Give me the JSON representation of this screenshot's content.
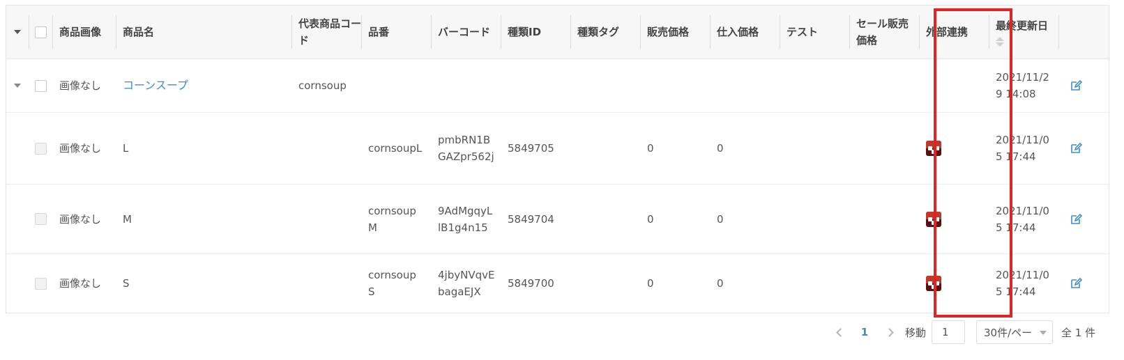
{
  "table": {
    "headers": [
      "商品画像",
      "商品名",
      "代表商品コード",
      "品番",
      "バーコード",
      "種類ID",
      "種類タグ",
      "販売価格",
      "仕入価格",
      "テスト",
      "セール販売価格",
      "外部連携",
      "最終更新日"
    ],
    "parent_row": {
      "image": "画像なし",
      "name": "コーンスープ",
      "code": "cornsoup",
      "updated": "2021/11/29 14:08"
    },
    "rows": [
      {
        "image": "画像なし",
        "name": "L",
        "part_no": "cornsoupL",
        "barcode": "pmbRN1BGAZpr562j",
        "type_id": "5849705",
        "sale_price": "0",
        "cost_price": "0",
        "updated": "2021/11/05 17:44"
      },
      {
        "image": "画像なし",
        "name": "M",
        "part_no": "cornsoupM",
        "barcode": "9AdMgqyLlB1g4n15",
        "type_id": "5849704",
        "sale_price": "0",
        "cost_price": "0",
        "updated": "2021/11/05 17:44"
      },
      {
        "image": "画像なし",
        "name": "S",
        "part_no": "cornsoupS",
        "barcode": "4jbyNVqvEbagaEJX",
        "type_id": "5849700",
        "sale_price": "0",
        "cost_price": "0",
        "updated": "2021/11/05 17:44"
      }
    ]
  },
  "pagination": {
    "current_page": "1",
    "jump_label": "移動",
    "jump_value": "1",
    "page_size": "30件/ペー",
    "total": "全 1 件"
  },
  "colors": {
    "link": "#3a8ed0",
    "highlight": "#e02424",
    "external_icon": "#c0392b"
  },
  "icons": {
    "external": "external-link-icon",
    "edit": "edit-icon"
  }
}
